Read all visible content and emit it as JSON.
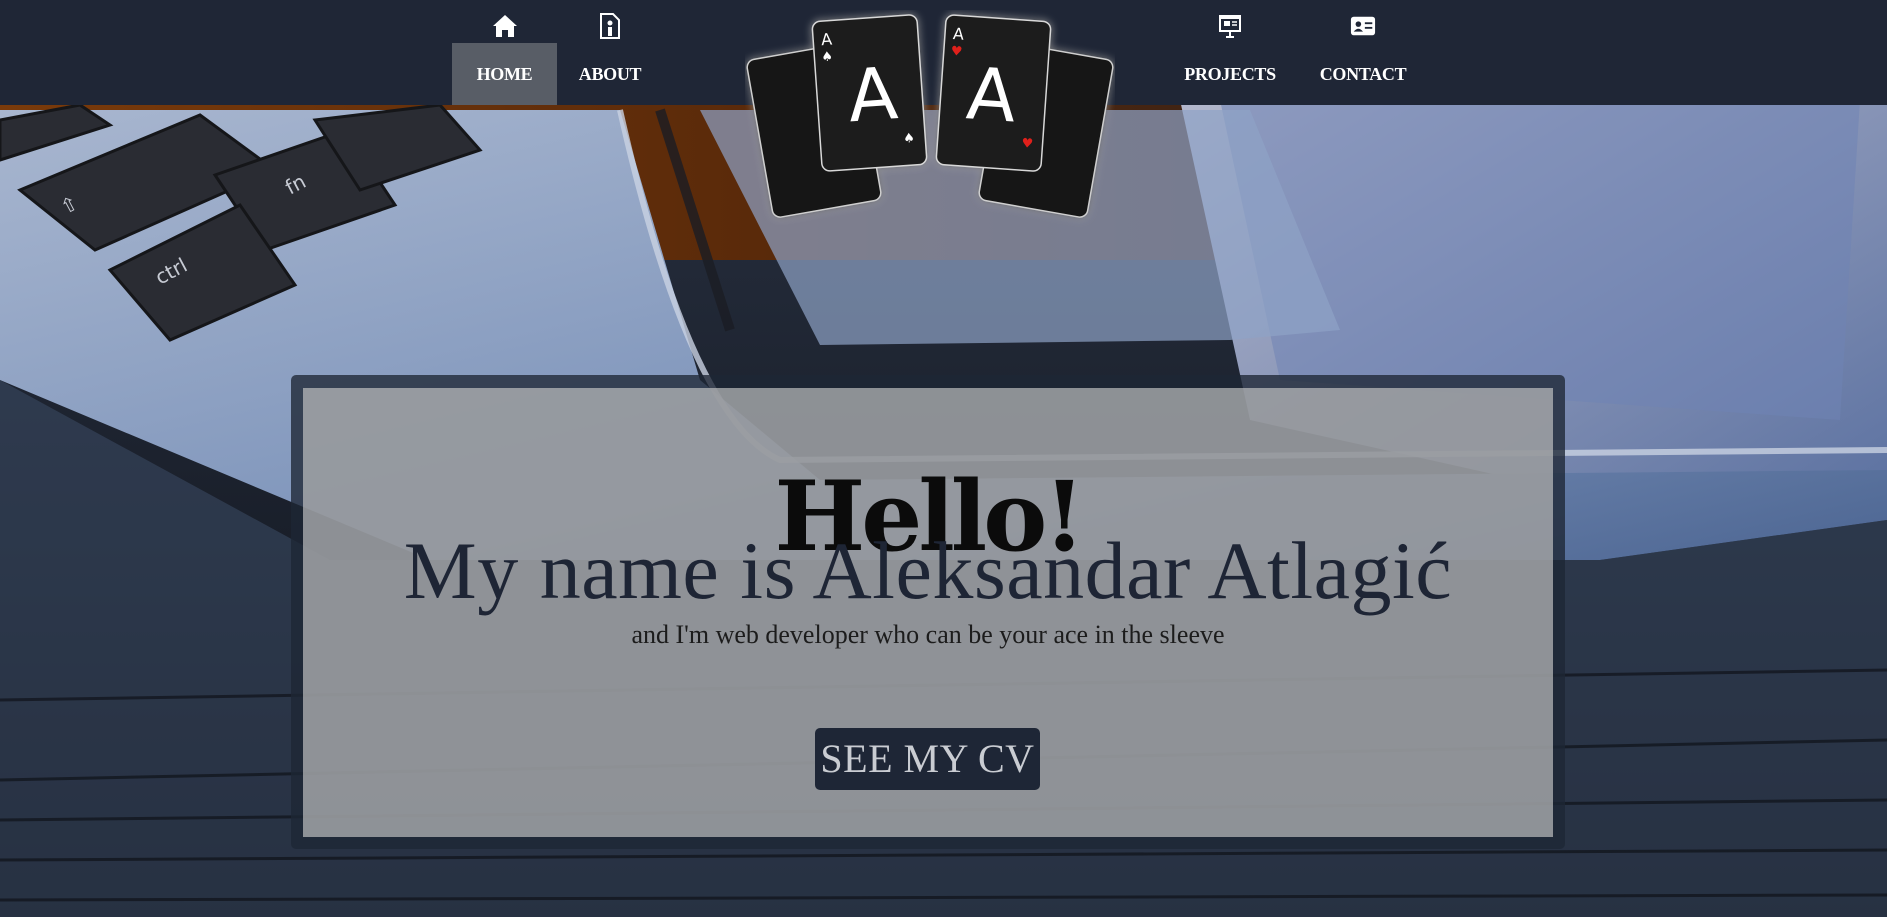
{
  "nav": {
    "items": [
      {
        "label": "HOME",
        "icon": "home-icon",
        "active": true
      },
      {
        "label": "ABOUT",
        "icon": "about-icon",
        "active": false
      },
      {
        "label": "PROJECTS",
        "icon": "presentation-icon",
        "active": false
      },
      {
        "label": "CONTACT",
        "icon": "contact-card-icon",
        "active": false
      }
    ]
  },
  "logo": {
    "left_card": {
      "rank": "A",
      "suit": "spade",
      "suit_color": "#ffffff"
    },
    "right_card": {
      "rank": "A",
      "suit": "heart",
      "suit_color": "#e0201b"
    }
  },
  "hero": {
    "title": "Hello!",
    "name_line": "My name is Aleksandar Atlagić",
    "subtitle": "and I'm web developer who can be your ace in the sleeve",
    "cv_button": "SEE MY CV"
  },
  "colors": {
    "nav_bg": "#1f2636",
    "nav_active": "#585d66",
    "button_bg": "#1e2636",
    "button_text": "#c9ccd2"
  }
}
